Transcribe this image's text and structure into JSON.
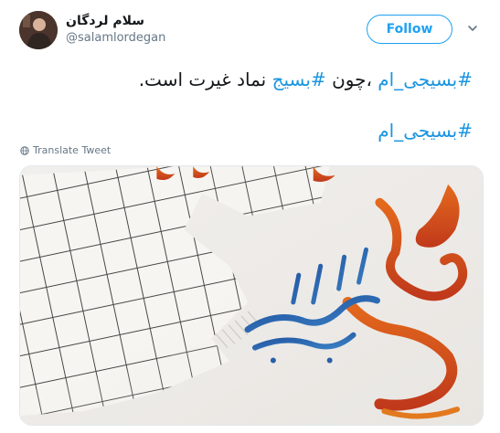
{
  "author": {
    "display_name": "سلام لردگان",
    "handle": "@salamlordegan"
  },
  "follow_label": "Follow",
  "tweet": {
    "line1": {
      "hashtag1": "#بسیجی_ام",
      "text1": "،چون",
      "hashtag2": "#بسیج",
      "text2": "نماد غیرت است."
    },
    "line2_hashtag": "#بسیجی_ام"
  },
  "translate_label": "Translate Tweet",
  "colors": {
    "accent": "#1da1f2",
    "hashtag": "#1b95e0",
    "muted": "#657786"
  },
  "icons": {
    "caret": "chevron-down-icon",
    "translate": "globe-icon"
  }
}
